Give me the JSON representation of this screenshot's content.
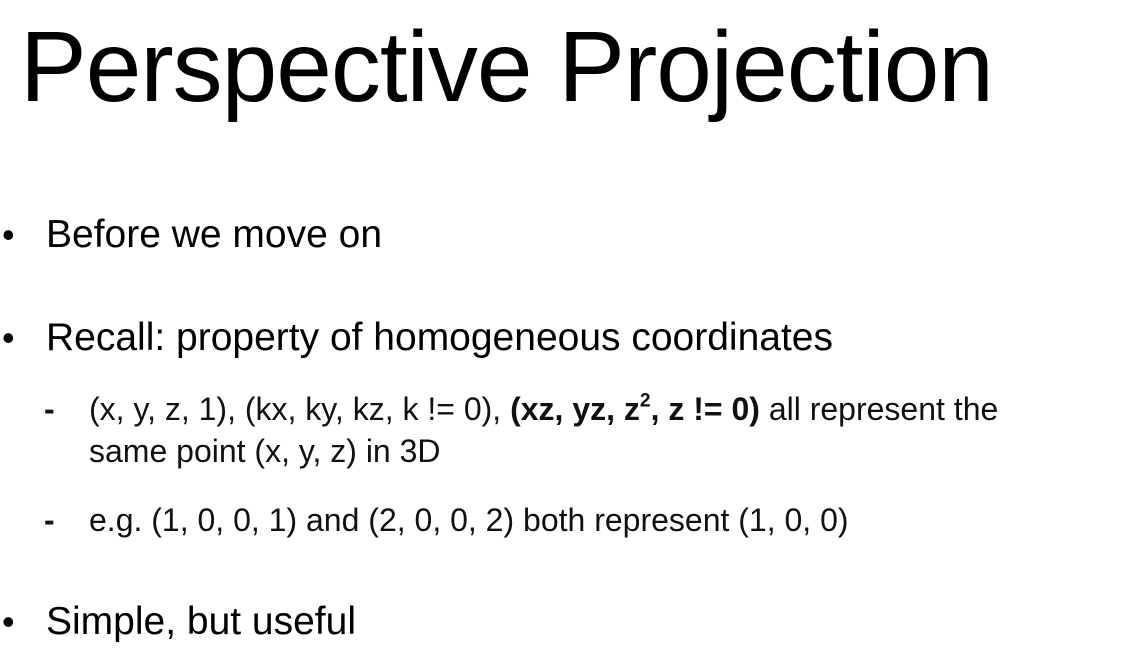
{
  "slide": {
    "title": "Perspective Projection",
    "bullets": [
      {
        "symbol": "•",
        "text": "Before we move on"
      },
      {
        "symbol": "•",
        "text": "Recall: property of homogeneous coordinates"
      },
      {
        "symbol": "•",
        "text": "Simple, but useful"
      }
    ],
    "subbullets": [
      {
        "symbol": "-",
        "part1": "(x, y, z, 1), (kx, ky, kz, k != 0), ",
        "bold_prefix": "(xz, yz, z",
        "bold_sup": "2",
        "bold_suffix": ", z != 0)",
        "part2": " all represent the same point (x, y, z) in 3D"
      },
      {
        "symbol": "-",
        "text": "e.g. (1, 0, 0, 1) and (2, 0, 0, 2) both represent (1, 0, 0)"
      }
    ]
  }
}
